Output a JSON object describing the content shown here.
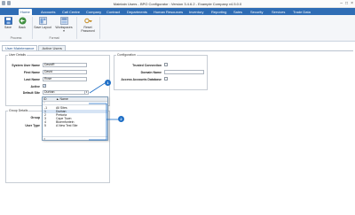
{
  "window": {
    "title": "Maintain Users - BPO Configurator : Version 3.4.6.2 - Example Company v4.5.0.0",
    "controls": [
      "–",
      "□",
      "×"
    ]
  },
  "ribbon_tabs": [
    "Home",
    "Accounts",
    "Call Centre",
    "Company",
    "Contract",
    "Departments",
    "Human Resources",
    "Inventory",
    "Reporting",
    "Sales",
    "Security",
    "Services",
    "Trade Data"
  ],
  "active_ribbon_tab": "Home",
  "ribbon": {
    "save": "Save",
    "back": "Back",
    "process_group": "Process",
    "save_layout": "Save Layout",
    "workspaces": "Workspaces",
    "format_group": "Format",
    "reset_password": "Reset Password"
  },
  "subtabs": [
    "User Maintenance",
    "Active Users"
  ],
  "user_details": {
    "group_title": "User Details",
    "system_user_name_label": "System User Name",
    "system_user_name": "DavidR",
    "first_name_label": "First Name",
    "first_name": "David",
    "last_name_label": "Last Name",
    "last_name": "Rose",
    "active_label": "Active",
    "active_checked": true,
    "default_site_label": "Default Site",
    "default_site": "Durban"
  },
  "group_details": {
    "group_title": "Group Details",
    "group_label": "Group",
    "user_type_label": "User Type"
  },
  "configuration": {
    "group_title": "Configuration",
    "trusted_connection_label": "Trusted Connection",
    "domain_name_label": "Domain Name",
    "access_accounts_db_label": "Access Accounts Database"
  },
  "dropdown": {
    "col_id": "ID",
    "col_name": "Name",
    "rows": [
      {
        "id": "-1",
        "name": "All Sites"
      },
      {
        "id": "1",
        "name": "Durban"
      },
      {
        "id": "2",
        "name": "Pretoria"
      },
      {
        "id": "3",
        "name": "Cape Town"
      },
      {
        "id": "4",
        "name": "Bloemfontein"
      },
      {
        "id": "5",
        "name": "A New Test Site"
      }
    ],
    "selected_index": 1
  },
  "markers": [
    "1",
    "2"
  ]
}
